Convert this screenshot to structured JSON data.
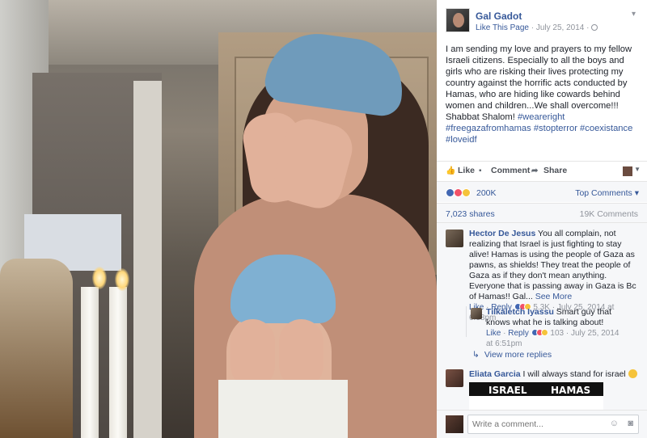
{
  "post": {
    "page_name": "Gal Gadot",
    "like_page": "Like This Page",
    "dot": " · ",
    "date": "July 25, 2014 · ",
    "text": "I am sending my love and prayers to my fellow Israeli citizens. Especially to all the boys and girls who are risking their lives protecting my country against the horrific acts conducted by Hamas, who are hiding like cowards behind women and children...We shall overcome!!! Shabbat Shalom!",
    "hashtags": "#weareright #freegazafromhamas #stopterror #coexistance #loveidf",
    "menu_icon": "chevron-down-icon"
  },
  "actions": {
    "like": "Like",
    "comment": "Comment",
    "share": "Share"
  },
  "reactions": {
    "count": "200K",
    "top_comments": "Top Comments",
    "colors": [
      "#4267b2",
      "#f25268",
      "#f5c33b"
    ]
  },
  "stats": {
    "shares": "7,023 shares",
    "comments": "19K Comments"
  },
  "comments": [
    {
      "name": "Hector De Jesus",
      "text": " You all complain, not realizing that Israel is just fighting to stay alive! Hamas is using the people of Gaza as pawns, as shields! They treat the people of Gaza as if they don't mean anything. Everyone that is passing away in Gaza is Bc of Hamas!! Gal...",
      "see_more": " See More",
      "like": "Like",
      "reply": "Reply",
      "reactions": "5.3K",
      "date": "· July 25, 2014 at 6:38pm"
    },
    {
      "name": "Tilkaletch Iyassu",
      "text": " Smart guy that knows what he is talking about!",
      "like": "Like",
      "reply": "Reply",
      "reactions": "103",
      "date": "· July 25, 2014 at 6:51pm"
    },
    {
      "name": "Eliata Garcia",
      "text": " I will always stand for israel ",
      "image_labels": [
        "ISRAEL",
        "HAMAS"
      ]
    }
  ],
  "view_more_replies": "View more replies",
  "composer": {
    "placeholder": "Write a comment..."
  }
}
